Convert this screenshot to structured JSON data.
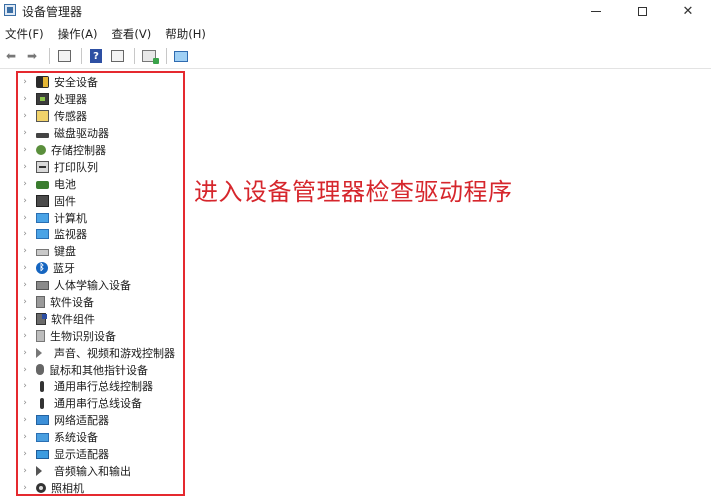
{
  "window": {
    "title": "设备管理器"
  },
  "menu": [
    {
      "label": "文件(F)"
    },
    {
      "label": "操作(A)"
    },
    {
      "label": "查看(V)"
    },
    {
      "label": "帮助(H)"
    }
  ],
  "toolbar": {
    "icons": [
      "back-arrow-icon",
      "forward-arrow-icon",
      "properties-icon",
      "help-icon",
      "update-driver-icon",
      "scan-hardware-icon",
      "monitor-icon"
    ]
  },
  "tree": {
    "items": [
      {
        "label": "安全设备",
        "icon": "security-device-icon"
      },
      {
        "label": "处理器",
        "icon": "processor-icon"
      },
      {
        "label": "传感器",
        "icon": "sensor-icon"
      },
      {
        "label": "磁盘驱动器",
        "icon": "disk-drive-icon"
      },
      {
        "label": "存储控制器",
        "icon": "storage-controller-icon"
      },
      {
        "label": "打印队列",
        "icon": "print-queue-icon"
      },
      {
        "label": "电池",
        "icon": "battery-icon"
      },
      {
        "label": "固件",
        "icon": "firmware-icon"
      },
      {
        "label": "计算机",
        "icon": "computer-icon"
      },
      {
        "label": "监视器",
        "icon": "monitor-icon"
      },
      {
        "label": "键盘",
        "icon": "keyboard-icon"
      },
      {
        "label": "蓝牙",
        "icon": "bluetooth-icon"
      },
      {
        "label": "人体学输入设备",
        "icon": "hid-icon"
      },
      {
        "label": "软件设备",
        "icon": "software-device-icon"
      },
      {
        "label": "软件组件",
        "icon": "software-component-icon"
      },
      {
        "label": "生物识别设备",
        "icon": "biometric-icon"
      },
      {
        "label": "声音、视频和游戏控制器",
        "icon": "sound-icon"
      },
      {
        "label": "鼠标和其他指针设备",
        "icon": "mouse-icon"
      },
      {
        "label": "通用串行总线控制器",
        "icon": "usb-controller-icon"
      },
      {
        "label": "通用串行总线设备",
        "icon": "usb-device-icon"
      },
      {
        "label": "网络适配器",
        "icon": "network-adapter-icon"
      },
      {
        "label": "系统设备",
        "icon": "system-device-icon"
      },
      {
        "label": "显示适配器",
        "icon": "display-adapter-icon"
      },
      {
        "label": "音频输入和输出",
        "icon": "audio-io-icon"
      },
      {
        "label": "照相机",
        "icon": "camera-icon"
      }
    ]
  },
  "annotation": {
    "text": "进入设备管理器检查驱动程序",
    "color": "#d6262c"
  },
  "highlight_color": "#e5292f"
}
